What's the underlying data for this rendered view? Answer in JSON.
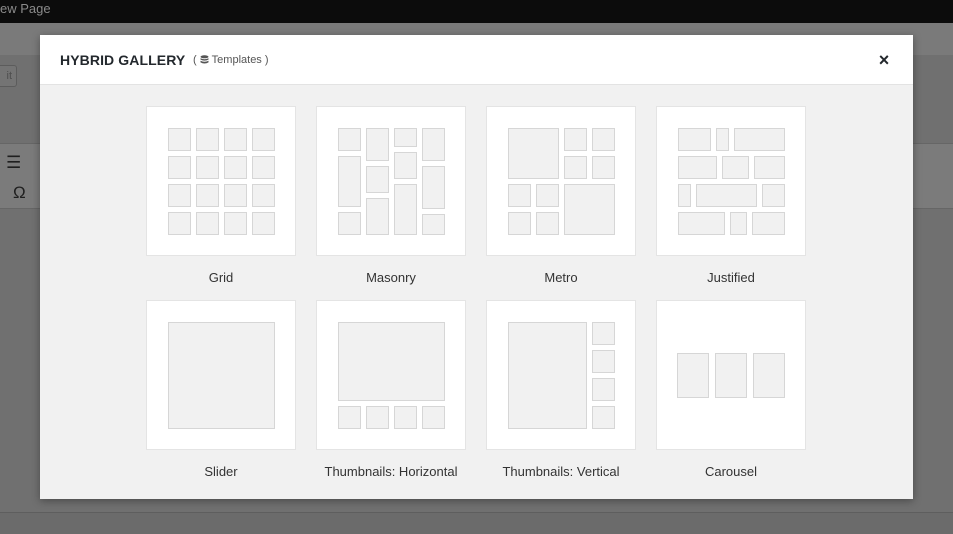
{
  "background": {
    "topbar_title": "ew Page",
    "edit_button": "it"
  },
  "modal": {
    "title": "HYBRID GALLERY",
    "subtitle_open": "(",
    "subtitle_label": "Templates",
    "subtitle_close": ")",
    "close_symbol": "×"
  },
  "templates": [
    {
      "label": "Grid"
    },
    {
      "label": "Masonry"
    },
    {
      "label": "Metro"
    },
    {
      "label": "Justified"
    },
    {
      "label": "Slider"
    },
    {
      "label": "Thumbnails: Horizontal"
    },
    {
      "label": "Thumbnails: Vertical"
    },
    {
      "label": "Carousel"
    }
  ],
  "colors": {
    "overlay_bg": "#6e6e6e",
    "modal_bg": "#f1f1f1",
    "header_bg": "#ffffff",
    "cell_fill": "#f1f1f1",
    "cell_stroke": "#d6d6d6"
  }
}
